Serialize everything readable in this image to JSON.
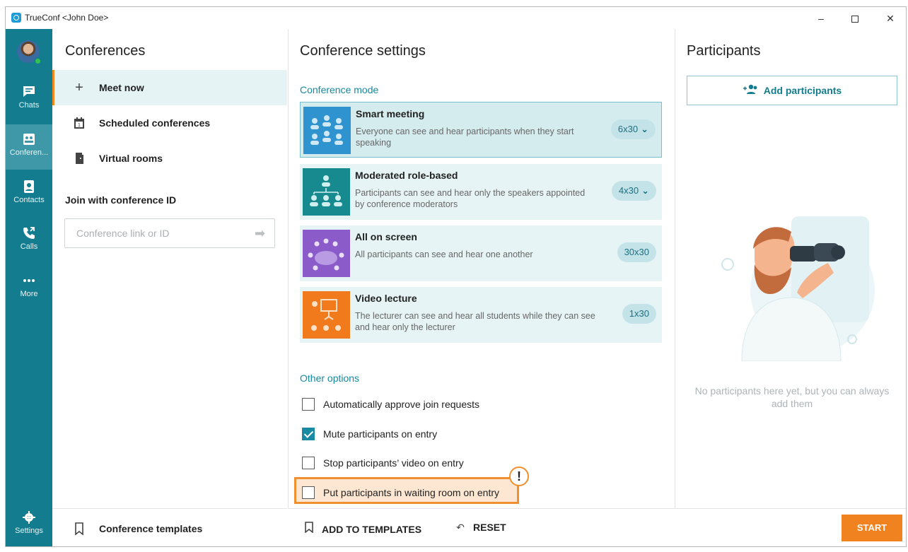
{
  "window": {
    "title": "TrueConf <John Doe>",
    "controls": [
      "–",
      "✕"
    ]
  },
  "rail": {
    "items": [
      {
        "label": "Chats",
        "icon": "chat-icon"
      },
      {
        "label": "Conferen...",
        "icon": "conference-icon",
        "active": true
      },
      {
        "label": "Contacts",
        "icon": "contacts-icon"
      },
      {
        "label": "Calls",
        "icon": "calls-icon"
      },
      {
        "label": "More",
        "icon": "more-icon"
      }
    ],
    "settings_label": "Settings"
  },
  "conferences": {
    "title": "Conferences",
    "menu": [
      {
        "label": "Meet now",
        "icon": "plus-icon",
        "active": true
      },
      {
        "label": "Scheduled conferences",
        "icon": "calendar-icon"
      },
      {
        "label": "Virtual rooms",
        "icon": "door-icon"
      }
    ],
    "join_label": "Join with conference ID",
    "join_placeholder": "Conference link or ID",
    "templates_label": "Conference templates"
  },
  "settings": {
    "title": "Conference settings",
    "mode_section": "Conference mode",
    "modes": [
      {
        "name": "Smart meeting",
        "desc": "Everyone can see and hear participants when they start speaking",
        "capacity": "6x30",
        "dropdown": true,
        "selected": true,
        "color": "#2f93cf"
      },
      {
        "name": "Moderated role-based",
        "desc": "Participants can see and hear only the speakers appointed by conference moderators",
        "capacity": "4x30",
        "dropdown": true,
        "selected": false,
        "color": "#168a8f"
      },
      {
        "name": "All on screen",
        "desc": "All participants can see and hear one another",
        "capacity": "30x30",
        "dropdown": false,
        "selected": false,
        "color": "#8a5bc9"
      },
      {
        "name": "Video lecture",
        "desc": "The lecturer can see and hear all students while they can see and hear only the lecturer",
        "capacity": "1x30",
        "dropdown": false,
        "selected": false,
        "color": "#f07a1c"
      }
    ],
    "options_section": "Other options",
    "options": [
      {
        "label": "Automatically approve join requests",
        "checked": false
      },
      {
        "label": "Mute participants on entry",
        "checked": true
      },
      {
        "label": "Stop participants’ video on entry",
        "checked": false
      },
      {
        "label": "Put participants in waiting room on entry",
        "checked": false,
        "highlighted": true
      }
    ],
    "warning_mark": "!",
    "add_to_templates": "ADD TO TEMPLATES",
    "reset": "RESET"
  },
  "participants": {
    "title": "Participants",
    "add_button": "Add participants",
    "empty_text": "No participants here yet, but you can always add them",
    "start_button": "START"
  },
  "colors": {
    "rail": "#137c8f",
    "accent": "#168aa1",
    "orange": "#f0831f"
  }
}
